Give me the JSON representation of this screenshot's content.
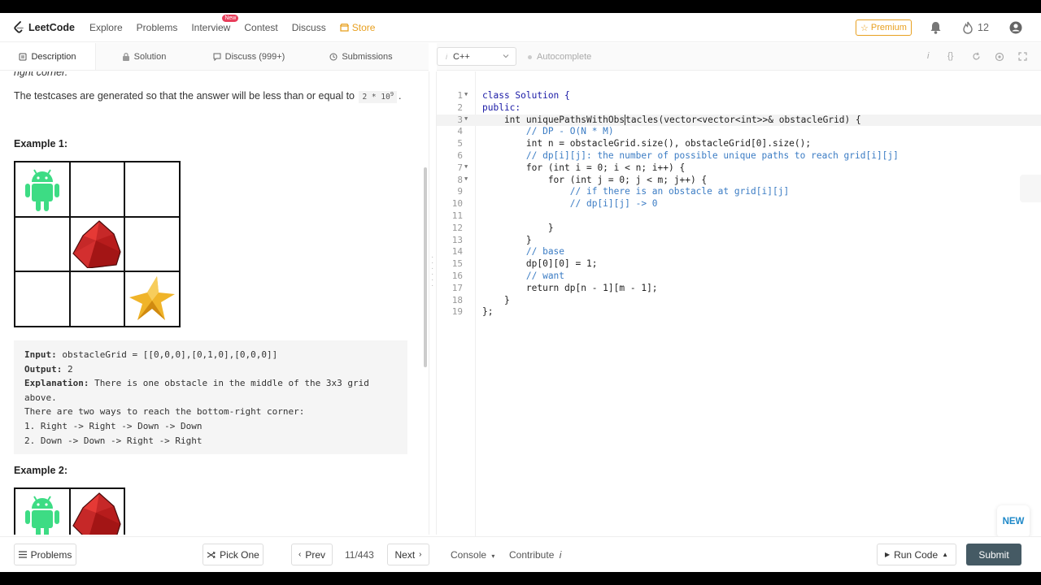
{
  "nav": {
    "brand": "LeetCode",
    "links": [
      "Explore",
      "Problems",
      "Interview",
      "Contest",
      "Discuss"
    ],
    "interview_badge": "New",
    "store": "Store",
    "premium": "Premium",
    "streak_count": "12"
  },
  "tabs": [
    {
      "label": "Description",
      "icon": "description-icon"
    },
    {
      "label": "Solution",
      "icon": "lock-icon"
    },
    {
      "label": "Discuss (999+)",
      "icon": "chat-icon"
    },
    {
      "label": "Submissions",
      "icon": "history-icon"
    }
  ],
  "editor_toolbar": {
    "language": "C++",
    "autocomplete": "Autocomplete"
  },
  "description": {
    "clipped_text": "right corner.",
    "constraint_text": "The testcases are generated so that the answer will be less than or equal to",
    "constraint_value": "2 * 10",
    "constraint_exp": "9",
    "example1_title": "Example 1:",
    "example1": {
      "input_label": "Input:",
      "input_value": "obstacleGrid = [[0,0,0],[0,1,0],[0,0,0]]",
      "output_label": "Output:",
      "output_value": "2",
      "explanation_label": "Explanation:",
      "explanation_value": "There is one obstacle in the middle of the 3x3 grid",
      "explanation_cont": "above.",
      "line4": "There are two ways to reach the bottom-right corner:",
      "line5": "1. Right -> Right -> Down -> Down",
      "line6": "2. Down -> Down -> Right -> Right"
    },
    "example2_title": "Example 2:"
  },
  "code": {
    "lines": [
      {
        "n": "1",
        "fold": true
      },
      {
        "n": "2",
        "fold": false
      },
      {
        "n": "3",
        "fold": true
      },
      {
        "n": "4",
        "fold": false
      },
      {
        "n": "5",
        "fold": false
      },
      {
        "n": "6",
        "fold": false
      },
      {
        "n": "7",
        "fold": true
      },
      {
        "n": "8",
        "fold": true
      },
      {
        "n": "9",
        "fold": false
      },
      {
        "n": "10",
        "fold": false
      },
      {
        "n": "11",
        "fold": false
      },
      {
        "n": "12",
        "fold": false
      },
      {
        "n": "13",
        "fold": false
      },
      {
        "n": "14",
        "fold": false
      },
      {
        "n": "15",
        "fold": false
      },
      {
        "n": "16",
        "fold": false
      },
      {
        "n": "17",
        "fold": false
      },
      {
        "n": "18",
        "fold": false
      },
      {
        "n": "19",
        "fold": false
      }
    ],
    "text": {
      "l1": "class Solution {",
      "l2": "public:",
      "l3a": "    int uniquePathsWithObs",
      "l3b": "tacles(vector<vector<int>>& obstacleGrid) {",
      "l4": "        // DP - O(N * M)",
      "l5": "        int n = obstacleGrid.size(), obstacleGrid[0].size();",
      "l6": "        // dp[i][j]: the number of possible unique paths to reach grid[i][j]",
      "l7": "        for (int i = 0; i < n; i++) {",
      "l8": "            for (int j = 0; j < m; j++) {",
      "l9": "                // if there is an obstacle at grid[i][j]",
      "l10": "                // dp[i][j] -> 0",
      "l11": "",
      "l12": "            }",
      "l13": "        }",
      "l14": "        // base",
      "l15": "        dp[0][0] = 1;",
      "l16": "        // want",
      "l17": "        return dp[n - 1][m - 1];",
      "l18": "    }",
      "l19": "};"
    }
  },
  "new_button": "NEW",
  "bottom": {
    "problems": "Problems",
    "pick_one": "Pick One",
    "prev": "Prev",
    "page": "11/443",
    "next": "Next",
    "console": "Console",
    "contribute": "Contribute",
    "run_code": "Run Code",
    "submit": "Submit"
  },
  "colors": {
    "accent_store": "#e8a020",
    "badge": "#e83e5b",
    "submit_bg": "#455a64",
    "android_green": "#3ddc84",
    "obstacle_red": "#c62828",
    "star_gold": "#f0b429"
  }
}
